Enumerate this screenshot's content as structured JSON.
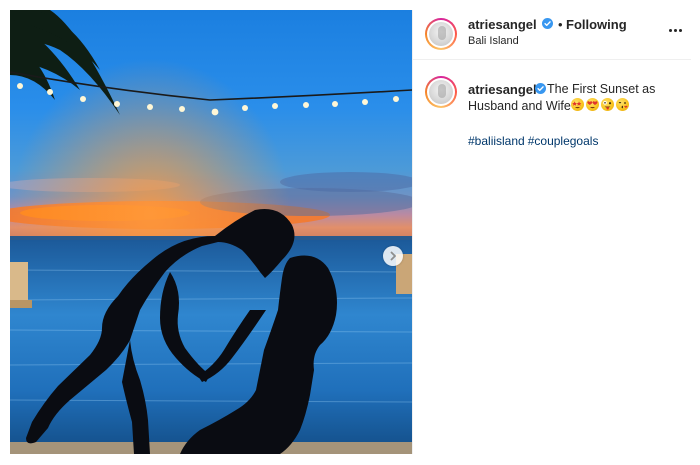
{
  "post": {
    "username": "atriesangel",
    "follow_status": "Following",
    "separator": "•",
    "location": "Bali Island",
    "more_icon": "more-horizontal-icon",
    "caption_line1": "The First Sunset as",
    "caption_line2": "Husband and Wife",
    "emojis": [
      "star-struck-emoji",
      "heart-eyes-emoji",
      "crazy-face-emoji",
      "kissing-face-emoji"
    ],
    "hashtags": [
      "#baliisland",
      "#couplegoals"
    ]
  },
  "media": {
    "next_icon": "chevron-right-icon"
  },
  "colors": {
    "verified": "#3897f0",
    "hashtag": "#00376b",
    "text": "#262626",
    "divider": "#efefef"
  }
}
